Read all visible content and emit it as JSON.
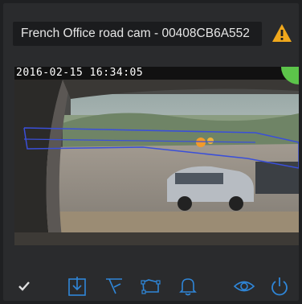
{
  "window": {
    "title": "French Office road cam - 00408CB6A552",
    "warning_icon": "warning-icon",
    "warning_color": "#f0a81c"
  },
  "video": {
    "timestamp": "2016-02-15  16:34:05",
    "status_color": "#5cc44a",
    "overlay_color": "#3a4fd9"
  },
  "toolbar": {
    "accent_color": "#2f86d8",
    "items": [
      {
        "icon": "checkmark-icon"
      },
      {
        "icon": "download-icon"
      },
      {
        "icon": "filter-icon"
      },
      {
        "icon": "region-icon"
      },
      {
        "icon": "bell-icon"
      },
      {
        "icon": "eye-icon"
      },
      {
        "icon": "power-icon"
      }
    ]
  }
}
